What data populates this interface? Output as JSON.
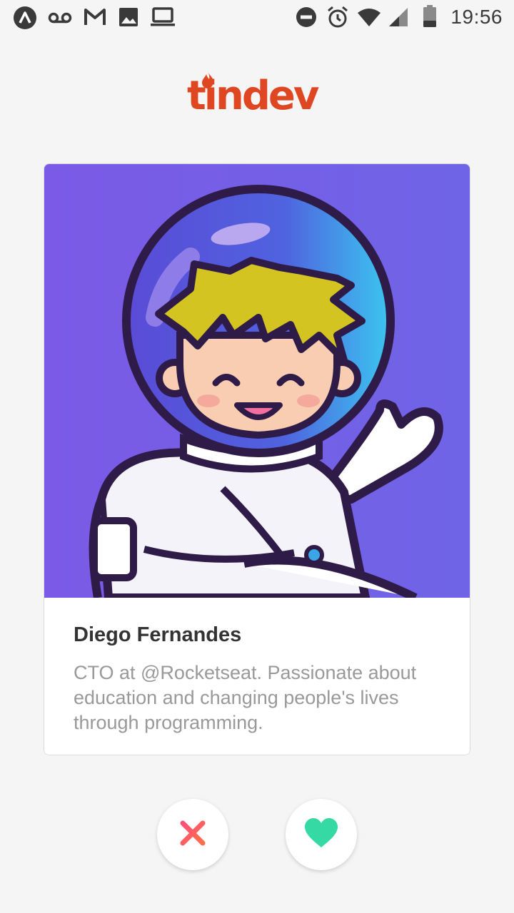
{
  "status_bar": {
    "time": "19:56",
    "left_icons": [
      "app-launcher-icon",
      "voicemail-icon",
      "gmail-icon",
      "image-icon",
      "laptop-icon"
    ],
    "right_icons": [
      "do-not-disturb-icon",
      "alarm-icon",
      "wifi-icon",
      "cell-signal-icon",
      "battery-icon"
    ]
  },
  "brand": {
    "logo_text": "tindev",
    "logo_color": "#df4723"
  },
  "profile": {
    "name": "Diego Fernandes",
    "bio": "CTO at @Rocketseat. Passionate about education and changing people's lives through programming.",
    "avatar": "astronaut-avatar",
    "avatar_background": "#7361e6"
  },
  "actions": {
    "dislike": {
      "icon": "close-x-icon",
      "color": "#ff5864"
    },
    "like": {
      "icon": "heart-icon",
      "color": "#34d9a3"
    }
  }
}
